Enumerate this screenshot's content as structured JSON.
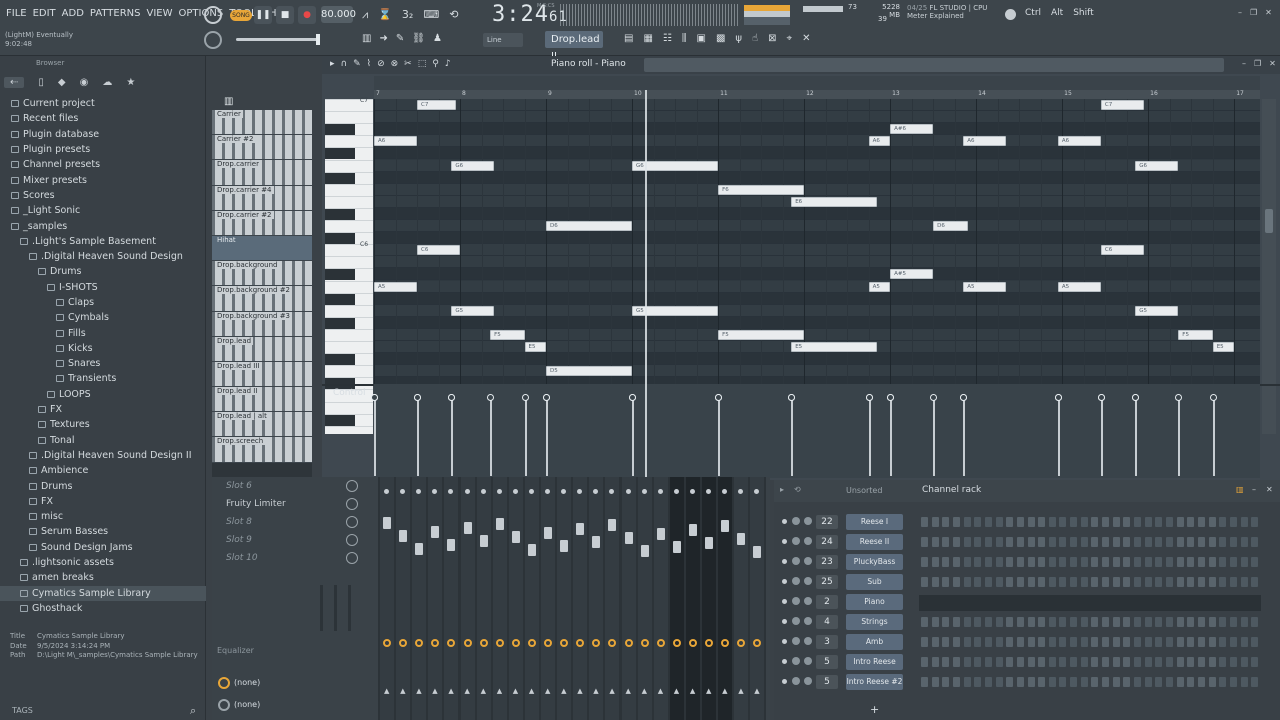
{
  "menu": [
    "FILE",
    "EDIT",
    "ADD",
    "PATTERNS",
    "VIEW",
    "OPTIONS",
    "TOOLS",
    "HELP"
  ],
  "hint": {
    "line1": "(LightM) Eventually",
    "line2": "9:02:48"
  },
  "transport": {
    "song_label": "SONG",
    "tempo": "80.000",
    "time_main": "3:24",
    "time_sub": "61",
    "time_mode": "M:S:CS"
  },
  "monitor": {
    "ram": "5228 MB",
    "ram_sub": "39",
    "cpu_val": "73",
    "news_date": "04/25",
    "news_title": "FL STUDIO | CPU",
    "news_sub": "Meter Explained"
  },
  "keys": [
    "Ctrl",
    "Alt",
    "Shift"
  ],
  "tools": {
    "snap_label": "Line",
    "pattern_selector": "Drop.lead II"
  },
  "browser": {
    "title": "Browser",
    "items": [
      {
        "label": "Current project",
        "indent": 0
      },
      {
        "label": "Recent files",
        "indent": 0
      },
      {
        "label": "Plugin database",
        "indent": 0
      },
      {
        "label": "Plugin presets",
        "indent": 0
      },
      {
        "label": "Channel presets",
        "indent": 0
      },
      {
        "label": "Mixer presets",
        "indent": 0
      },
      {
        "label": "Scores",
        "indent": 0
      },
      {
        "label": "_Light Sonic",
        "indent": 0
      },
      {
        "label": "_samples",
        "indent": 0
      },
      {
        "label": ".Light's Sample Basement",
        "indent": 1
      },
      {
        "label": ".Digital Heaven Sound Design",
        "indent": 2
      },
      {
        "label": "Drums",
        "indent": 3
      },
      {
        "label": "I-SHOTS",
        "indent": 4
      },
      {
        "label": "Claps",
        "indent": 5
      },
      {
        "label": "Cymbals",
        "indent": 5
      },
      {
        "label": "Fills",
        "indent": 5
      },
      {
        "label": "Kicks",
        "indent": 5
      },
      {
        "label": "Snares",
        "indent": 5
      },
      {
        "label": "Transients",
        "indent": 5
      },
      {
        "label": "LOOPS",
        "indent": 4
      },
      {
        "label": "FX",
        "indent": 3
      },
      {
        "label": "Textures",
        "indent": 3
      },
      {
        "label": "Tonal",
        "indent": 3
      },
      {
        "label": ".Digital Heaven Sound Design II",
        "indent": 2
      },
      {
        "label": "Ambience",
        "indent": 2
      },
      {
        "label": "Drums",
        "indent": 2
      },
      {
        "label": "FX",
        "indent": 2
      },
      {
        "label": "misc",
        "indent": 2
      },
      {
        "label": "Serum Basses",
        "indent": 2
      },
      {
        "label": "Sound Design Jams",
        "indent": 2
      },
      {
        "label": ".lightsonic assets",
        "indent": 1
      },
      {
        "label": "amen breaks",
        "indent": 1
      },
      {
        "label": "Cymatics Sample Library",
        "indent": 1
      },
      {
        "label": "Ghosthack",
        "indent": 1
      }
    ],
    "info_title_label": "Title",
    "info_title": "Cymatics Sample Library",
    "info_date_label": "Date",
    "info_date": "9/5/2024 3:14:24 PM",
    "info_path_label": "Path",
    "info_path": "D:\\Light M\\_samples\\Cymatics Sample Library",
    "tags": "TAGS"
  },
  "patterns": [
    "Carrier",
    "Carrier #2",
    "Drop.carrier",
    "Drop.carrier #4",
    "Drop.carrier #2",
    "Hihat",
    "Drop.background",
    "Drop.background #2",
    "Drop.background #3",
    "Drop.lead",
    "Drop.lead III",
    "Drop.lead II",
    "Drop.lead | alt",
    "Drop.screech"
  ],
  "piano_roll": {
    "title": "Piano roll - Piano",
    "bars": [
      "7",
      "8",
      "9",
      "10",
      "11",
      "12",
      "13",
      "14",
      "15",
      "16",
      "17"
    ],
    "octave_labels": [
      "C7",
      "C6"
    ],
    "control_label": "Control",
    "notes": [
      {
        "label": "C7",
        "bar": 7.5,
        "len": 0.45,
        "row": 0
      },
      {
        "label": "A6",
        "bar": 7.0,
        "len": 0.5,
        "row": 3
      },
      {
        "label": "G6",
        "bar": 7.9,
        "len": 0.5,
        "row": 5
      },
      {
        "label": "D6",
        "bar": 9.0,
        "len": 1.0,
        "row": 10
      },
      {
        "label": "C6",
        "bar": 7.5,
        "len": 0.5,
        "row": 12
      },
      {
        "label": "A5",
        "bar": 7.0,
        "len": 0.5,
        "row": 15
      },
      {
        "label": "G5",
        "bar": 7.9,
        "len": 0.5,
        "row": 17
      },
      {
        "label": "F5",
        "bar": 8.35,
        "len": 0.4,
        "row": 19
      },
      {
        "label": "E5",
        "bar": 8.75,
        "len": 0.25,
        "row": 20
      },
      {
        "label": "D5",
        "bar": 9.0,
        "len": 1.0,
        "row": 22
      },
      {
        "label": "G6",
        "bar": 10.0,
        "len": 1.0,
        "row": 5
      },
      {
        "label": "G5",
        "bar": 10.0,
        "len": 1.0,
        "row": 17
      },
      {
        "label": "F6",
        "bar": 11.0,
        "len": 1.0,
        "row": 7
      },
      {
        "label": "E6",
        "bar": 11.85,
        "len": 1.0,
        "row": 8
      },
      {
        "label": "F5",
        "bar": 11.0,
        "len": 1.0,
        "row": 19
      },
      {
        "label": "E5",
        "bar": 11.85,
        "len": 1.0,
        "row": 20
      },
      {
        "label": "A6",
        "bar": 12.75,
        "len": 0.25,
        "row": 3
      },
      {
        "label": "A#6",
        "bar": 13.0,
        "len": 0.5,
        "row": 2
      },
      {
        "label": "A5",
        "bar": 12.75,
        "len": 0.25,
        "row": 15
      },
      {
        "label": "A#5",
        "bar": 13.0,
        "len": 0.5,
        "row": 14
      },
      {
        "label": "D6",
        "bar": 13.5,
        "len": 0.4,
        "row": 10
      },
      {
        "label": "A6",
        "bar": 13.85,
        "len": 0.5,
        "row": 3
      },
      {
        "label": "A5",
        "bar": 13.85,
        "len": 0.5,
        "row": 15
      },
      {
        "label": "A6",
        "bar": 14.95,
        "len": 0.5,
        "row": 3
      },
      {
        "label": "A5",
        "bar": 14.95,
        "len": 0.5,
        "row": 15
      },
      {
        "label": "C7",
        "bar": 15.45,
        "len": 0.5,
        "row": 0
      },
      {
        "label": "C6",
        "bar": 15.45,
        "len": 0.5,
        "row": 12
      },
      {
        "label": "G6",
        "bar": 15.85,
        "len": 0.5,
        "row": 5
      },
      {
        "label": "G5",
        "bar": 15.85,
        "len": 0.5,
        "row": 17
      },
      {
        "label": "F5",
        "bar": 16.35,
        "len": 0.4,
        "row": 19
      },
      {
        "label": "E5",
        "bar": 16.75,
        "len": 0.25,
        "row": 20
      }
    ],
    "playhead_bar": 10.15
  },
  "mixer": {
    "slots": [
      "Slot 6",
      "Fruity Limiter",
      "Slot 8",
      "Slot 9",
      "Slot 10"
    ],
    "eq_label": "Equalizer",
    "none1": "(none)",
    "none2": "(none)",
    "track_numbers": [
      "12",
      "13",
      "15",
      "18",
      "21",
      "24",
      "27"
    ]
  },
  "channel_rack": {
    "title": "Channel rack",
    "filter": "Unsorted",
    "channels": [
      {
        "num": "22",
        "name": "Reese I"
      },
      {
        "num": "24",
        "name": "Reese II"
      },
      {
        "num": "23",
        "name": "PluckyBass"
      },
      {
        "num": "25",
        "name": "Sub"
      },
      {
        "num": "2",
        "name": "Piano"
      },
      {
        "num": "4",
        "name": "Strings"
      },
      {
        "num": "3",
        "name": "Amb"
      },
      {
        "num": "5",
        "name": "Intro Reese"
      },
      {
        "num": "5",
        "name": "Intro Reese #2"
      }
    ],
    "add_button": "+"
  },
  "colors": {
    "accent": "#e8a638",
    "note": "#e9ecee",
    "grid_bg": "#2f3940",
    "channel_button": "#5a6a7c"
  }
}
